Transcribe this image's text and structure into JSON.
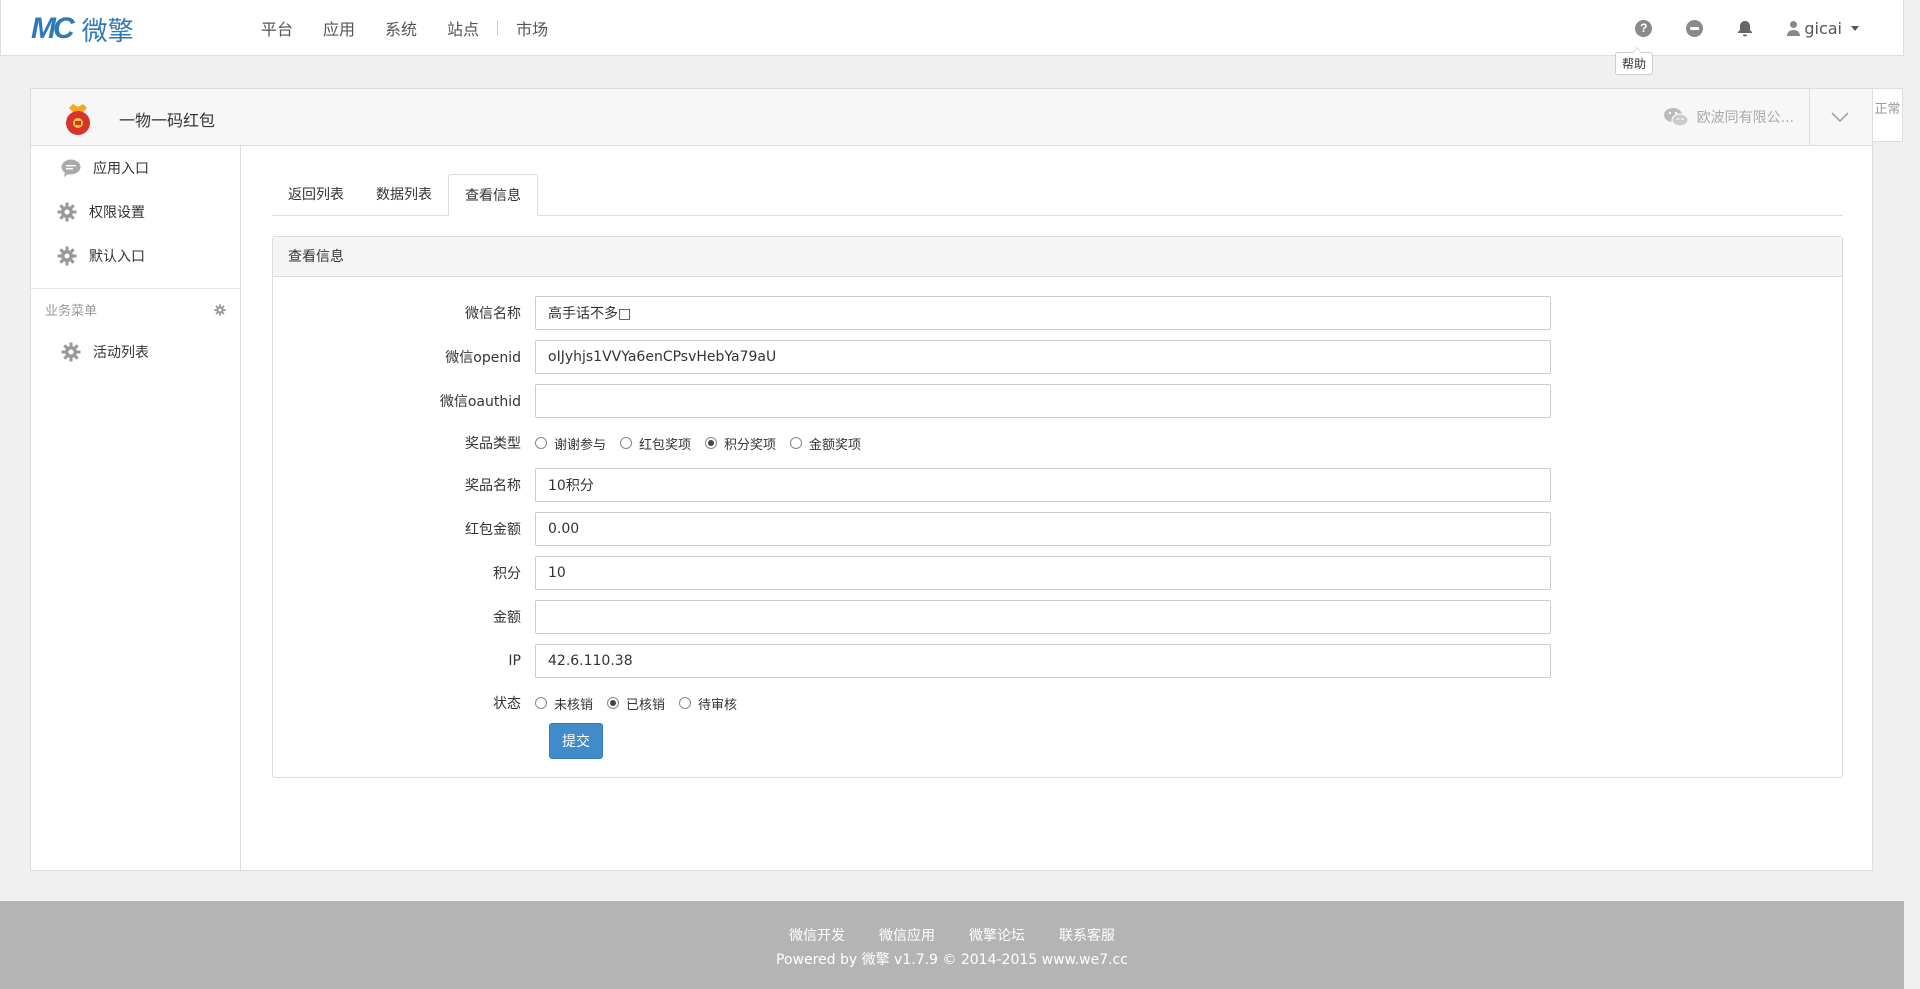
{
  "brand": {
    "mark": "MC",
    "name": "微擎",
    "color": "#2f79b9"
  },
  "nav": {
    "items": [
      "平台",
      "应用",
      "系统",
      "站点",
      "市场"
    ],
    "help_tooltip": "帮助",
    "user": "gicai",
    "icons": [
      "question-icon",
      "chat-icon",
      "bell-icon",
      "user-icon"
    ]
  },
  "app": {
    "title": "一物一码红包",
    "account": "欧波同有限公...",
    "status_tab": "正常"
  },
  "sidebar": {
    "items": [
      {
        "label": "应用入口",
        "icon": "chat-bubble-icon"
      },
      {
        "label": "权限设置",
        "icon": "gear-icon"
      },
      {
        "label": "默认入口",
        "icon": "gear-icon"
      }
    ],
    "section": "业务菜单",
    "section_items": [
      {
        "label": "活动列表",
        "icon": "gear-icon"
      }
    ]
  },
  "tabs": [
    "返回列表",
    "数据列表",
    "查看信息"
  ],
  "panel_title": "查看信息",
  "form": {
    "wechat_name": {
      "label": "微信名称",
      "value": "高手话不多□"
    },
    "openid": {
      "label": "微信openid",
      "value": "oIJyhjs1VVYa6enCPsvHebYa79aU"
    },
    "oauthid": {
      "label": "微信oauthid",
      "value": ""
    },
    "prize_type": {
      "label": "奖品类型",
      "options": [
        "谢谢参与",
        "红包奖项",
        "积分奖项",
        "金额奖项"
      ],
      "selected": "积分奖项"
    },
    "prize_name": {
      "label": "奖品名称",
      "value": "10积分"
    },
    "redpack_amount": {
      "label": "红包金额",
      "value": "0.00"
    },
    "points": {
      "label": "积分",
      "value": "10"
    },
    "amount": {
      "label": "金额",
      "value": ""
    },
    "ip": {
      "label": "IP",
      "value": "42.6.110.38"
    },
    "status": {
      "label": "状态",
      "options": [
        "未核销",
        "已核销",
        "待审核"
      ],
      "selected": "已核销"
    },
    "submit": "提交"
  },
  "footer": {
    "links": [
      "微信开发",
      "微信应用",
      "微擎论坛",
      "联系客服"
    ],
    "copyright": "Powered by 微擎 v1.7.9 © 2014-2015 www.we7.cc"
  }
}
